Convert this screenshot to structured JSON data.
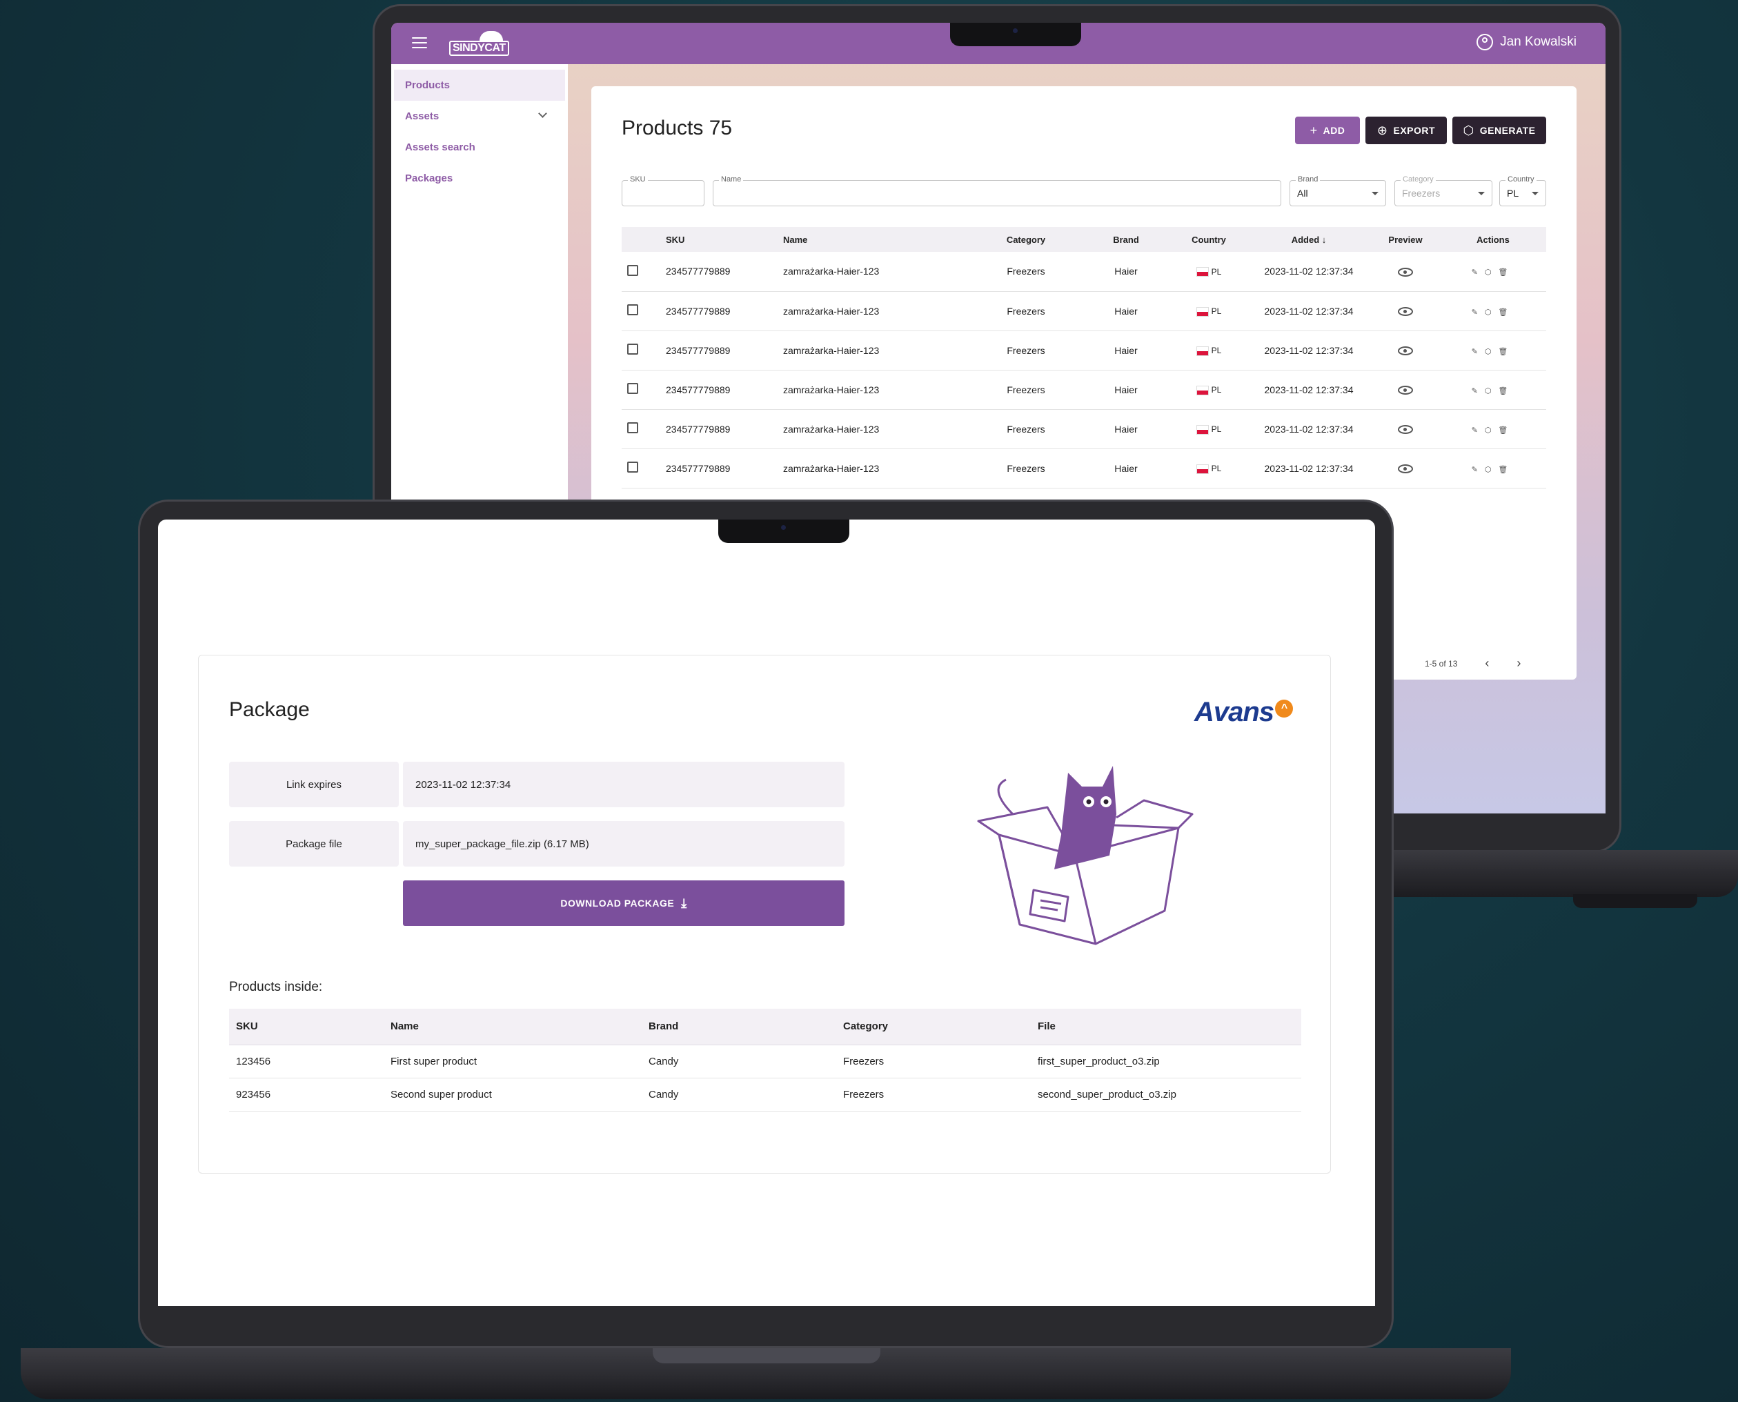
{
  "back": {
    "app": {
      "logo_text": "SINDYCAT",
      "user_name": "Jan Kowalski"
    },
    "sidebar": {
      "items": [
        {
          "label": "Products"
        },
        {
          "label": "Assets"
        },
        {
          "label": "Assets search"
        },
        {
          "label": "Packages"
        }
      ]
    },
    "products": {
      "title": "Products 75",
      "buttons": {
        "add": "ADD",
        "export": "EXPORT",
        "generate": "GENERATE"
      },
      "filters": {
        "sku_label": "SKU",
        "name_label": "Name",
        "brand_label": "Brand",
        "brand_value": "All",
        "category_label": "Category",
        "category_value": "Freezers",
        "country_label": "Country",
        "country_value": "PL"
      },
      "columns": [
        "SKU",
        "Name",
        "Category",
        "Brand",
        "Country",
        "Added",
        "Preview",
        "Actions"
      ],
      "rows": [
        {
          "sku": "234577779889",
          "name": "zamrażarka-Haier-123",
          "category": "Freezers",
          "brand": "Haier",
          "country": "PL",
          "added": "2023-11-02 12:37:34"
        },
        {
          "sku": "234577779889",
          "name": "zamrażarka-Haier-123",
          "category": "Freezers",
          "brand": "Haier",
          "country": "PL",
          "added": "2023-11-02 12:37:34"
        },
        {
          "sku": "234577779889",
          "name": "zamrażarka-Haier-123",
          "category": "Freezers",
          "brand": "Haier",
          "country": "PL",
          "added": "2023-11-02 12:37:34"
        },
        {
          "sku": "234577779889",
          "name": "zamrażarka-Haier-123",
          "category": "Freezers",
          "brand": "Haier",
          "country": "PL",
          "added": "2023-11-02 12:37:34"
        },
        {
          "sku": "234577779889",
          "name": "zamrażarka-Haier-123",
          "category": "Freezers",
          "brand": "Haier",
          "country": "PL",
          "added": "2023-11-02 12:37:34"
        },
        {
          "sku": "234577779889",
          "name": "zamrażarka-Haier-123",
          "category": "Freezers",
          "brand": "Haier",
          "country": "PL",
          "added": "2023-11-02 12:37:34"
        }
      ],
      "pagination": "1-5 of 13"
    }
  },
  "front": {
    "package": {
      "title": "Package",
      "retailer_logo": "Avans",
      "link_expires_label": "Link expires",
      "link_expires_value": "2023-11-02 12:37:34",
      "file_label": "Package file",
      "file_value": "my_super_package_file.zip  (6.17 MB)",
      "download_label": "DOWNLOAD PACKAGE",
      "products_inside_title": "Products inside:",
      "columns": [
        "SKU",
        "Name",
        "Brand",
        "Category",
        "File"
      ],
      "rows": [
        {
          "sku": "123456",
          "name": "First super product",
          "brand": "Candy",
          "category": "Freezers",
          "file": "first_super_product_o3.zip"
        },
        {
          "sku": "923456",
          "name": "Second super product",
          "brand": "Candy",
          "category": "Freezers",
          "file": "second_super_product_o3.zip"
        }
      ]
    }
  },
  "colors": {
    "brand_purple": "#8e5ca6",
    "button_dark": "#2c2230",
    "download_purple": "#7b4f9c",
    "avans_blue": "#1d3b8f",
    "avans_orange": "#f08a1c"
  }
}
